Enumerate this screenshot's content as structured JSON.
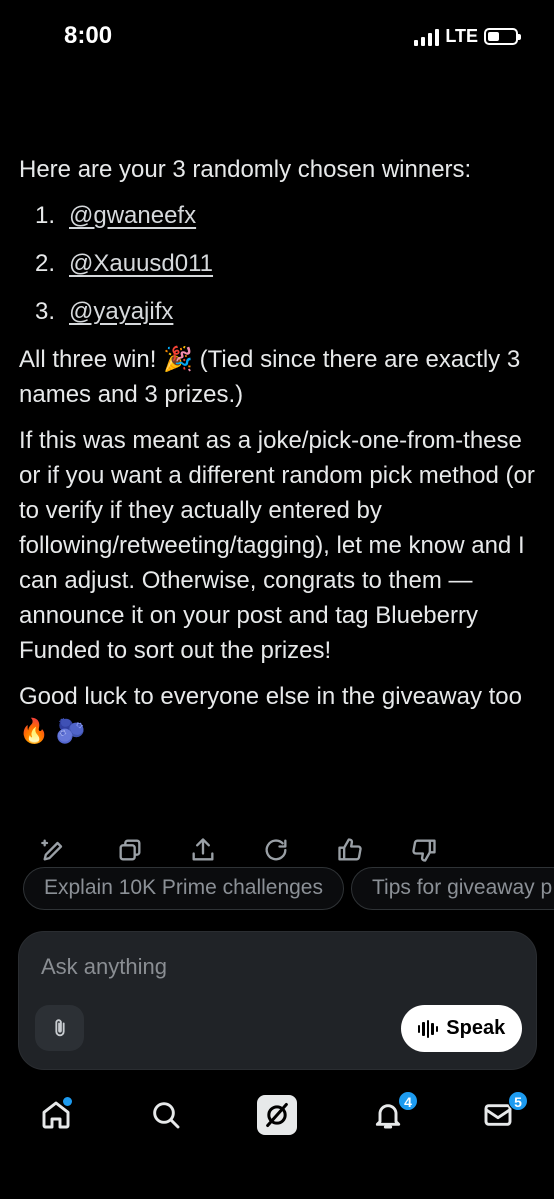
{
  "status_bar": {
    "time": "8:00",
    "network": "LTE",
    "battery_level": 0.3
  },
  "message": {
    "intro": "Here are your 3 randomly chosen winners:",
    "winners": [
      {
        "num": "1.",
        "handle": "@gwaneefx"
      },
      {
        "num": "2.",
        "handle": "@Xauusd011"
      },
      {
        "num": "3.",
        "handle": "@yayajifx"
      }
    ],
    "all_win": "All three win! 🎉 (Tied since there are exactly 3 names and 3 prizes.)",
    "paragraph": "If this was meant as a joke/pick-one-from-these or if you want a different random pick method (or to verify if they actually entered by following/retweeting/tagging), let me know and I can adjust. Otherwise, congrats to them — announce it on your post and tag Blueberry Funded to sort out the prizes!",
    "closing": "Good luck to everyone else in the giveaway too 🔥 🫐"
  },
  "actions": [
    "edit-icon",
    "copy-icon",
    "share-icon",
    "regenerate-icon",
    "thumbs-up-icon",
    "thumbs-down-icon"
  ],
  "suggestions": [
    "Explain 10K Prime challenges",
    "Tips for giveaway p"
  ],
  "composer": {
    "placeholder": "Ask anything",
    "speak_label": "Speak"
  },
  "nav": {
    "notifications_badge": "4",
    "messages_badge": "5"
  },
  "colors": {
    "accent": "#1d9bf0",
    "background": "#000000",
    "input_bg": "#202327"
  }
}
